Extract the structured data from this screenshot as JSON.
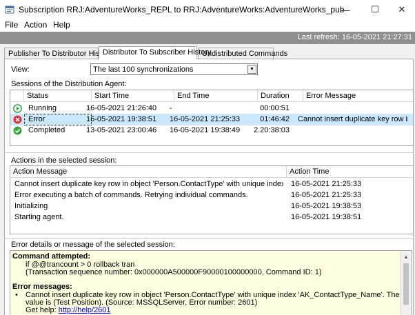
{
  "window": {
    "title": "Subscription RRJ:AdventureWorks_REPL to RRJ:AdventureWorks:AdventureWorks_pub",
    "minimize": "—",
    "maximize": "☐",
    "close": "✕"
  },
  "menu": [
    "File",
    "Action",
    "Help"
  ],
  "refresh": "Last refresh: 16-05-2021 21:27:31",
  "tabs": [
    "Publisher To Distributor History",
    "Distributor To Subscriber History",
    "Undistributed Commands"
  ],
  "active_tab": 1,
  "view": {
    "label": "View:",
    "value": "The last 100 synchronizations"
  },
  "sessions": {
    "label": "Sessions of the Distribution Agent:",
    "columns": [
      "Status",
      "Start Time",
      "End Time",
      "Duration",
      "Error Message"
    ],
    "rows": [
      {
        "status": "Running",
        "icon": "running-icon",
        "start": "16-05-2021 21:26:40",
        "end": "-",
        "duration": "00:00:51",
        "error": "",
        "selected": false
      },
      {
        "status": "Error",
        "icon": "error-icon",
        "start": "16-05-2021 19:38:51",
        "end": "16-05-2021 21:25:33",
        "duration": "01:46:42",
        "error": "Cannot insert duplicate key row in ...",
        "selected": true
      },
      {
        "status": "Completed",
        "icon": "completed-icon",
        "start": "13-05-2021 23:00:46",
        "end": "16-05-2021 19:38:49",
        "duration": "2.20:38:03",
        "error": "",
        "selected": false
      }
    ]
  },
  "actions": {
    "label": "Actions in the selected session:",
    "columns": [
      "Action Message",
      "Action Time"
    ],
    "rows": [
      {
        "message": "Cannot insert duplicate key row in object 'Person.ContactType' with unique index 'AK_Conta...",
        "time": "16-05-2021 21:25:33"
      },
      {
        "message": "Error executing a batch of commands. Retrying individual commands.",
        "time": "16-05-2021 21:25:33"
      },
      {
        "message": "Initializing",
        "time": "16-05-2021 19:38:53"
      },
      {
        "message": "Starting agent.",
        "time": "16-05-2021 19:38:51"
      }
    ]
  },
  "details": {
    "label": "Error details or message of the selected session:",
    "command_heading": "Command attempted:",
    "command_line1": "if @@trancount > 0 rollback tran",
    "command_line2": "(Transaction sequence number: 0x000000A500000F90000100000000, Command ID: 1)",
    "errors_heading": "Error messages:",
    "bullet": "•",
    "error_line1": "Cannot insert duplicate key row in object 'Person.ContactType' with unique index 'AK_ContactType_Name'. The duplicate key",
    "error_line2": "value is (Test Position). (Source: MSSQLServer, Error number: 2601)",
    "help_prefix": "Get help: ",
    "help_link": "http://help/2601"
  },
  "colors": {
    "selected_row": "#cce8ff",
    "details_bg": "#ffffe1",
    "refresh_bar": "#8f8f8f",
    "running": "#1e9e3a",
    "error": "#d9363e",
    "completed": "#3aa53a"
  }
}
